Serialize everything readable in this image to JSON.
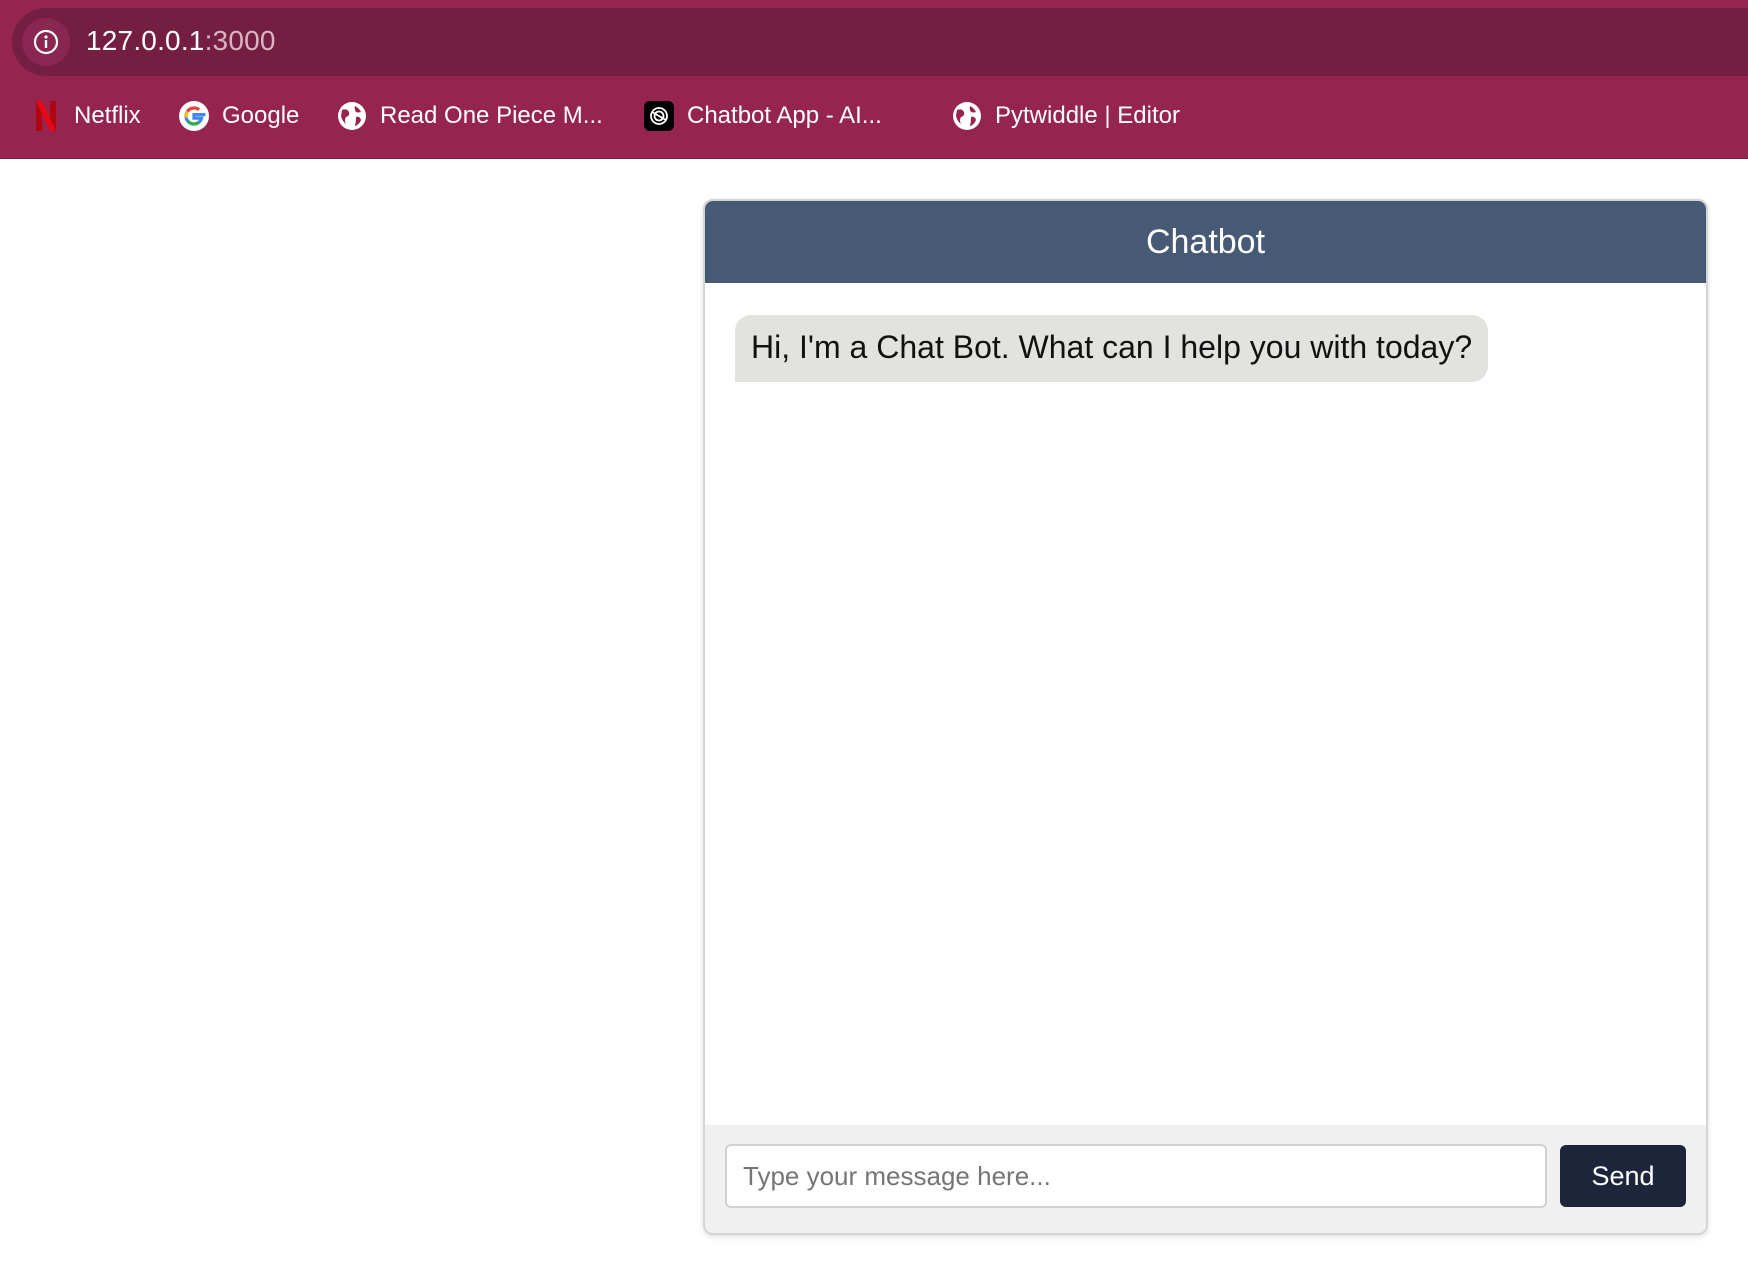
{
  "browser": {
    "url_host": "127.0.0.1",
    "url_port": ":3000",
    "bookmarks": [
      {
        "label": "Netflix",
        "icon": "netflix-icon"
      },
      {
        "label": "Google",
        "icon": "google-icon"
      },
      {
        "label": "Read One Piece M...",
        "icon": "globe-icon"
      },
      {
        "label": "Chatbot App - AI...",
        "icon": "chatbot-app-icon"
      },
      {
        "label": "Pytwiddle | Editor",
        "icon": "globe-icon"
      }
    ],
    "colors": {
      "toolbar": "#95244f",
      "address_bar": "#741f42"
    }
  },
  "chat": {
    "title": "Chatbot",
    "messages": [
      {
        "sender": "bot",
        "text": "Hi, I'm a Chat Bot. What can I help you with today?"
      }
    ],
    "input_placeholder": "Type your message here...",
    "input_value": "",
    "send_label": "Send",
    "colors": {
      "header": "#465a75",
      "send_button": "#1c253a",
      "bubble": "#e2e2df"
    }
  }
}
